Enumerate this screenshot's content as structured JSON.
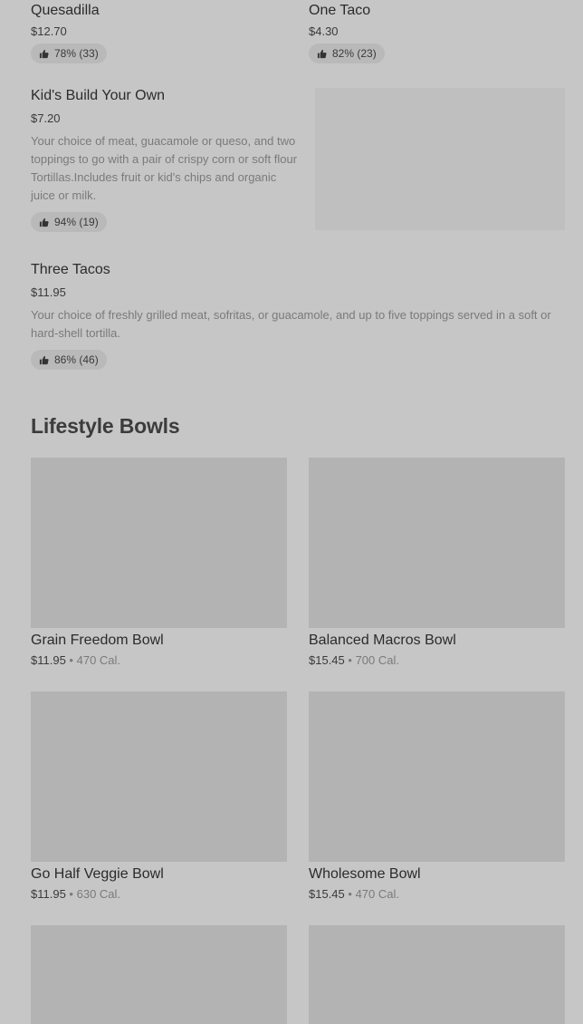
{
  "top_items": [
    {
      "name": "Quesadilla",
      "price": "$12.70",
      "rating": "78% (33)"
    },
    {
      "name": "One Taco",
      "price": "$4.30",
      "rating": "82% (23)"
    }
  ],
  "kids": {
    "name": "Kid's Build Your Own",
    "price": "$7.20",
    "description": "Your choice of meat, guacamole or queso, and two toppings to go with a pair of crispy corn or soft flour Tortillas.Includes fruit or kid's chips and organic juice or milk.",
    "rating": "94% (19)"
  },
  "three_tacos": {
    "name": "Three Tacos",
    "price": "$11.95",
    "description": "Your choice of freshly grilled meat, sofritas, or guacamole, and up to five toppings served in a soft or hard-shell tortilla.",
    "rating": "86% (46)"
  },
  "section": {
    "title": "Lifestyle Bowls"
  },
  "bowls": [
    {
      "name": "Grain Freedom Bowl",
      "price": "$11.95",
      "sep": "•",
      "calories": "470 Cal."
    },
    {
      "name": "Balanced Macros Bowl",
      "price": "$15.45",
      "sep": "•",
      "calories": "700 Cal."
    },
    {
      "name": "Go Half Veggie Bowl",
      "price": "$11.95",
      "sep": "•",
      "calories": "630 Cal."
    },
    {
      "name": "Wholesome Bowl",
      "price": "$15.45",
      "sep": "•",
      "calories": "470 Cal."
    }
  ],
  "colors": {
    "background": "#c6c6c6",
    "placeholder": "#b3b3b3",
    "pill": "#b9b9b9"
  }
}
